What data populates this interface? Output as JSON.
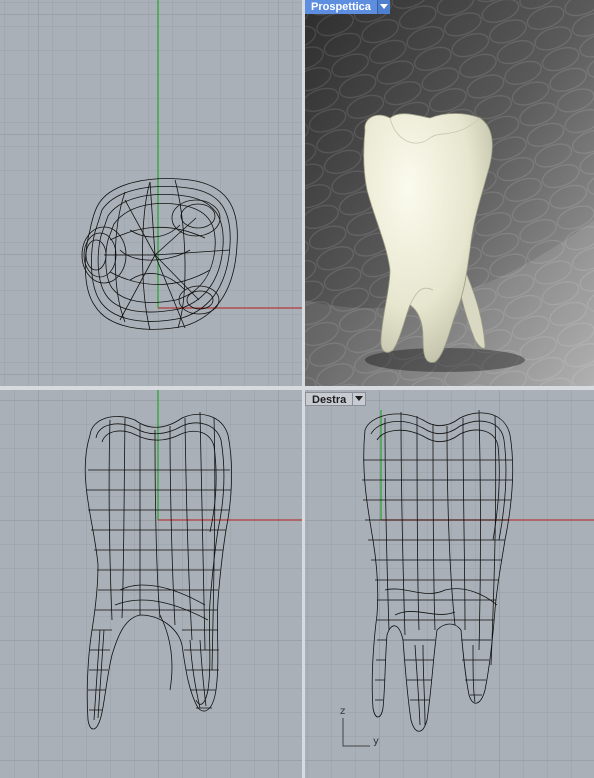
{
  "viewports": {
    "perspective": {
      "title": "Prospettica",
      "active": true
    },
    "right": {
      "title": "Destra",
      "active": false
    }
  },
  "axis_widget": {
    "vertical": "z",
    "horizontal": "y"
  },
  "icons": {
    "dropdown": "chevron-down-icon"
  },
  "colors": {
    "grid_bg": "#a9b0b7",
    "grid_line": "#99a0a7",
    "axis_x": "#b33b3b",
    "axis_y": "#2fa33a",
    "active_title": "#5e8ee0"
  }
}
